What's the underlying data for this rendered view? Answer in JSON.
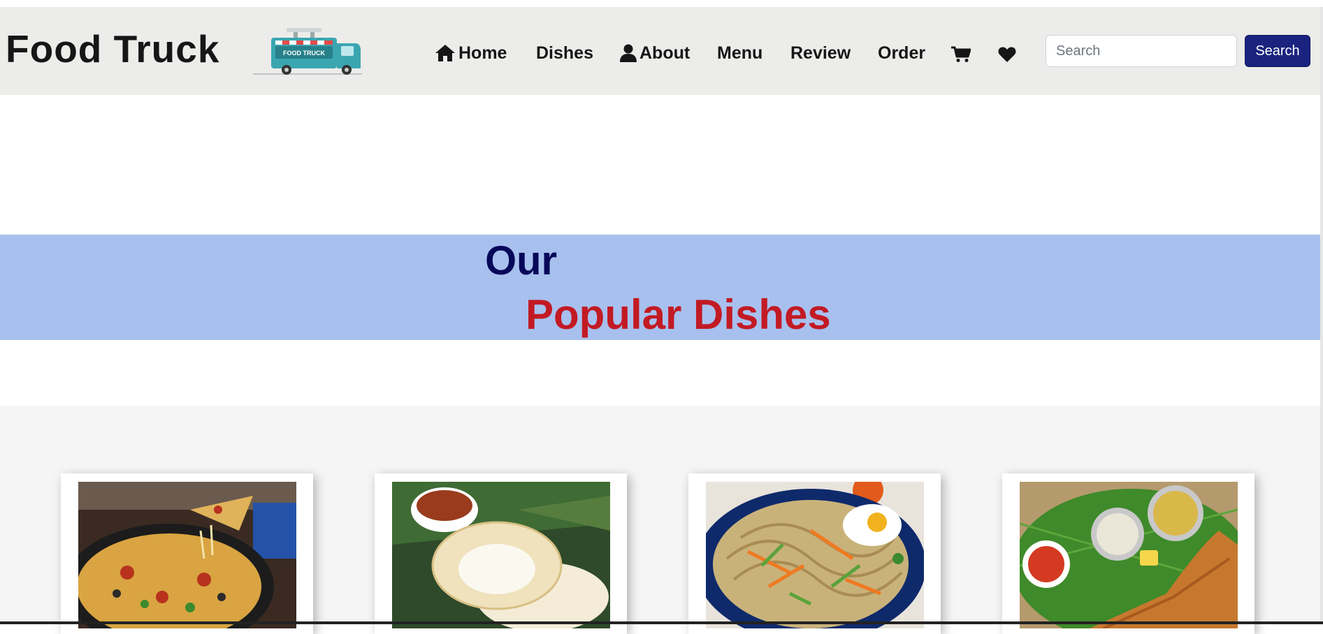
{
  "brand": {
    "title": "Food Truck",
    "logo_text": "FOOD TRUCK"
  },
  "nav": {
    "items": [
      {
        "label": "Home",
        "icon": "home-icon"
      },
      {
        "label": "Dishes"
      },
      {
        "label": "About",
        "icon": "user-icon"
      },
      {
        "label": "Menu"
      },
      {
        "label": "Review"
      },
      {
        "label": "Order"
      }
    ],
    "icons": [
      "cart-icon",
      "heart-icon"
    ]
  },
  "search": {
    "placeholder": "Search",
    "value": "",
    "button_label": "Search"
  },
  "banner": {
    "line1": "Our",
    "line2": "Popular Dishes"
  },
  "dishes": [
    {
      "image": "pizza-image"
    },
    {
      "image": "appam-image"
    },
    {
      "image": "noodles-image"
    },
    {
      "image": "dosa-image"
    }
  ],
  "colors": {
    "navbar_bg": "#ececea",
    "search_button": "#1a237e",
    "banner_bg": "#a8c0ee",
    "banner_heading_dark": "#08085a",
    "banner_heading_red": "#c21a24",
    "section_bg": "#f5f5f5"
  }
}
